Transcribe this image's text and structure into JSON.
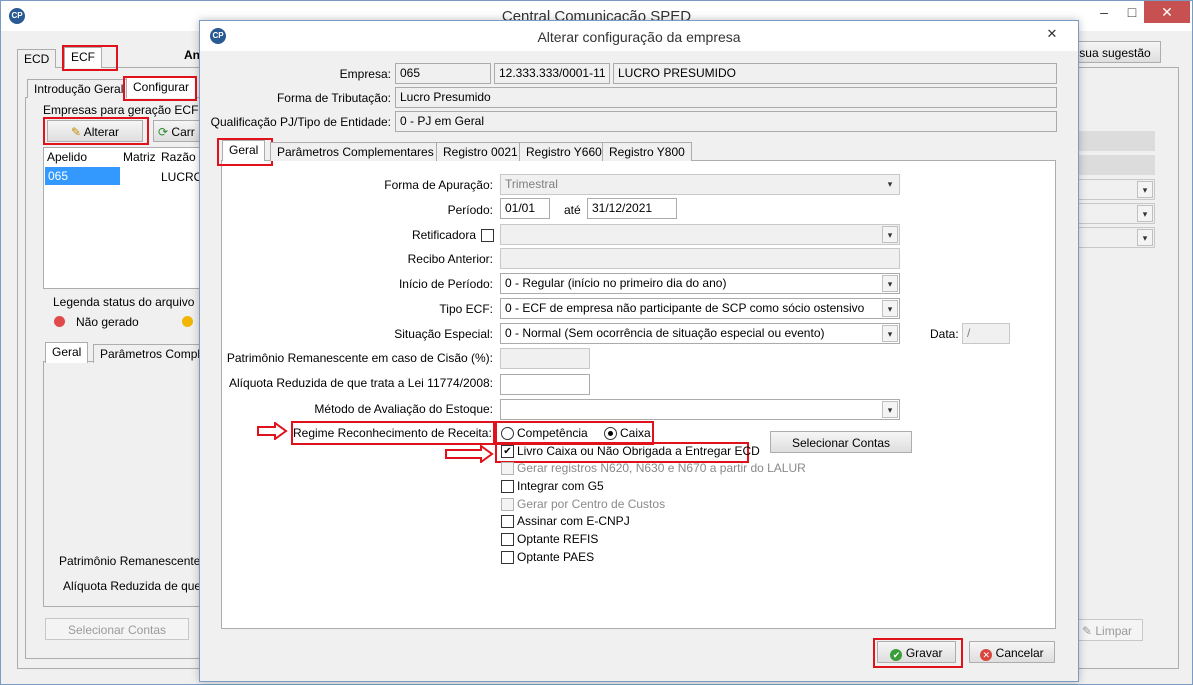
{
  "main_window": {
    "title": "Central Comunicação SPED",
    "logo": "CP",
    "top_tabs": [
      "ECD",
      "ECF"
    ],
    "partial_label": "An",
    "suggestion_button": "sua sugestão",
    "sub_tabs": [
      "Introdução Geral",
      "Configurar"
    ],
    "group_title": "Empresas para geração ECF (1",
    "alterar_button": "Alterar",
    "carregar_button": "Carr",
    "grid_headers": [
      "Apelido",
      "Matriz",
      "Razão"
    ],
    "grid_row": [
      "065",
      "",
      "LUCRO"
    ],
    "legend_title": "Legenda status do arquivo",
    "legend_item": "Não gerado",
    "lower_tabs": [
      "Geral",
      "Parâmetros Comple"
    ],
    "lower_label1": "Patrimônio Remanescente",
    "lower_label2": "Alíquota Reduzida de que",
    "selecionar_contas_button": "Selecionar Contas",
    "limpar_button": "Limpar",
    "window_buttons": {
      "minimize": "–",
      "maximize": "□",
      "close": "✕"
    }
  },
  "dialog": {
    "title": "Alterar configuração da empresa",
    "logo": "CP",
    "empresa_label": "Empresa:",
    "empresa_code": "065",
    "empresa_cnpj": "12.333.333/0001-11",
    "empresa_name": "LUCRO PRESUMIDO",
    "tributacao_label": "Forma de Tributação:",
    "tributacao_value": "Lucro Presumido",
    "qualificacao_label": "Qualificação PJ/Tipo de Entidade:",
    "qualificacao_value": "0 - PJ em Geral",
    "tabs": [
      "Geral",
      "Parâmetros Complementares",
      "Registro 0021",
      "Registro Y660",
      "Registro Y800"
    ],
    "apuracao_label": "Forma de Apuração:",
    "apuracao_value": "Trimestral",
    "periodo_label": "Período:",
    "periodo_start": "01/01",
    "periodo_ate": "até",
    "periodo_end": "31/12/2021",
    "retificadora_label": "Retificadora",
    "recibo_label": "Recibo Anterior:",
    "inicio_label": "Início de Período:",
    "inicio_value": "0 - Regular (início no primeiro dia do ano)",
    "tipo_label": "Tipo ECF:",
    "tipo_value": "0 - ECF de empresa não participante de SCP como sócio ostensivo",
    "situacao_label": "Situação Especial:",
    "situacao_value": "0 - Normal (Sem ocorrência de situação especial ou evento)",
    "data_label": "Data:",
    "data_value": "/",
    "patrimonio_label": "Patrimônio Remanescente em caso de Cisão (%):",
    "aliquota_label": "Alíquota Reduzida de que trata a Lei 11774/2008:",
    "metodo_label": "Método de Avaliação do Estoque:",
    "regime_label": "Regime Reconhecimento de Receita:",
    "regime_options": [
      "Competência",
      "Caixa"
    ],
    "selecionar_contas_button": "Selecionar Contas",
    "checkboxes": [
      {
        "label": "Livro Caixa ou Não Obrigada a Entregar ECD",
        "checked": true,
        "disabled": false
      },
      {
        "label": "Gerar registros N620, N630 e N670 a partir do LALUR",
        "checked": false,
        "disabled": true
      },
      {
        "label": "Integrar com G5",
        "checked": false,
        "disabled": false
      },
      {
        "label": "Gerar por Centro de Custos",
        "checked": false,
        "disabled": true
      },
      {
        "label": "Assinar com E-CNPJ",
        "checked": false,
        "disabled": false
      },
      {
        "label": "Optante REFIS",
        "checked": false,
        "disabled": false
      },
      {
        "label": "Optante PAES",
        "checked": false,
        "disabled": false
      }
    ],
    "gravar_button": "Gravar",
    "cancelar_button": "Cancelar",
    "close_glyph": "✕"
  },
  "colors": {
    "highlight": "#e0121c",
    "selection": "#3399ff",
    "title_accent": "#2a5a93"
  }
}
